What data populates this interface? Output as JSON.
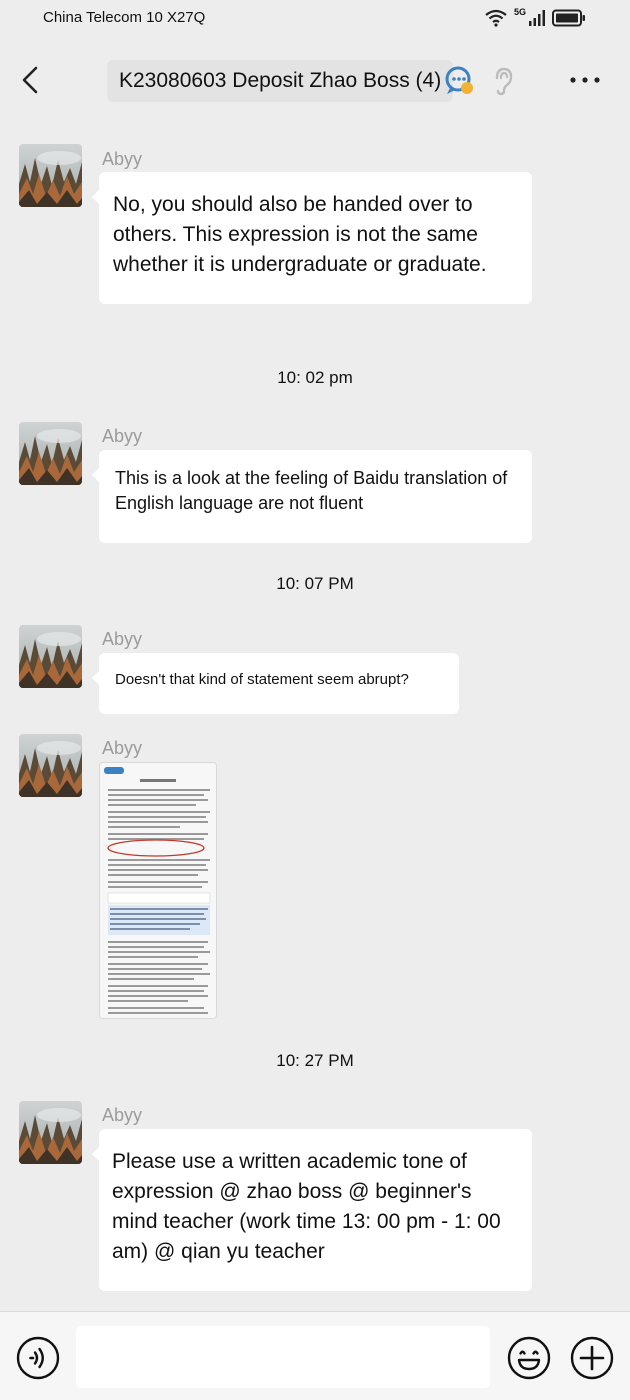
{
  "status_bar": {
    "carrier": "China Telecom 10 X27Q",
    "network": "5G"
  },
  "header": {
    "title": "K23080603 Deposit Zhao Boss (4)"
  },
  "messages": [
    {
      "sender": "Abyy",
      "text": "No, you should also be handed over to others. This expression is not the same whether it is undergraduate or graduate."
    },
    {
      "sender": "Abyy",
      "text": "This is a look at the feeling of Baidu translation of English language are not fluent"
    },
    {
      "sender": "Abyy",
      "text": "Doesn't that kind of statement seem abrupt?"
    },
    {
      "sender": "Abyy",
      "image": "document-screenshot"
    },
    {
      "sender": "Abyy",
      "text": "Please use a written academic tone of expression @ zhao boss @ beginner's mind teacher (work time 13: 00 pm - 1: 00 am) @ qian yu teacher"
    }
  ],
  "timestamps": [
    "10: 02 pm",
    "10: 07 PM",
    "10: 27 PM"
  ],
  "input_bar": {
    "placeholder": ""
  },
  "colors": {
    "background": "#ededed",
    "bubble": "#ffffff",
    "sender_name": "#9b9b9b"
  }
}
